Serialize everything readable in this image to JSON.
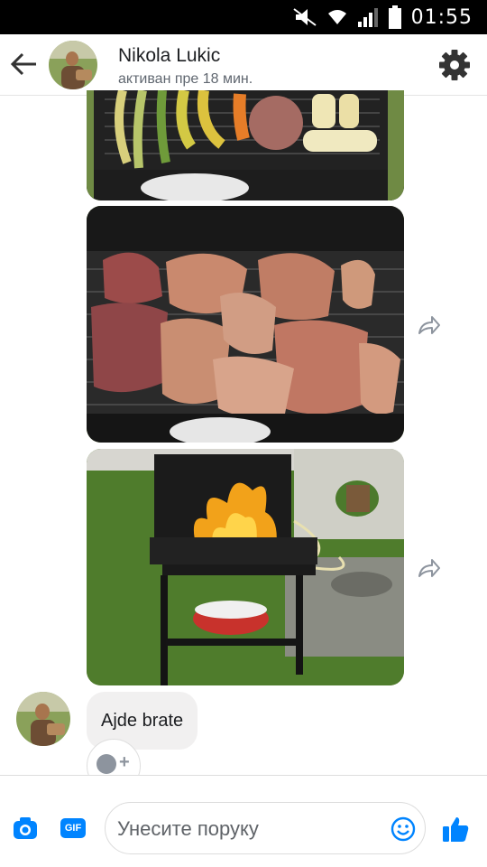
{
  "status_bar": {
    "time": "01:55",
    "icons": [
      "mute-icon",
      "wifi-icon",
      "signal-icon",
      "battery-icon"
    ]
  },
  "header": {
    "contact_name": "Nikola Lukic",
    "status": "активан пре 18 мин.",
    "icons": [
      "back-arrow-icon",
      "gear-icon"
    ]
  },
  "messages": [
    {
      "type": "photo",
      "content": "grill-with-peppers-corn-meat"
    },
    {
      "type": "photo",
      "content": "grill-full-of-meat"
    },
    {
      "type": "photo",
      "content": "grill-with-fire"
    },
    {
      "type": "text",
      "text": "Ajde brate"
    }
  ],
  "composer": {
    "placeholder": "Унесите поруку",
    "gif_label": "GIF",
    "icons": [
      "camera-icon",
      "gif-icon",
      "emoji-icon",
      "thumbs-up-icon"
    ]
  },
  "colors": {
    "accent": "#0084ff",
    "bubble": "#f1f0f0",
    "status_bar": "#000000",
    "secondary_text": "#606770"
  }
}
